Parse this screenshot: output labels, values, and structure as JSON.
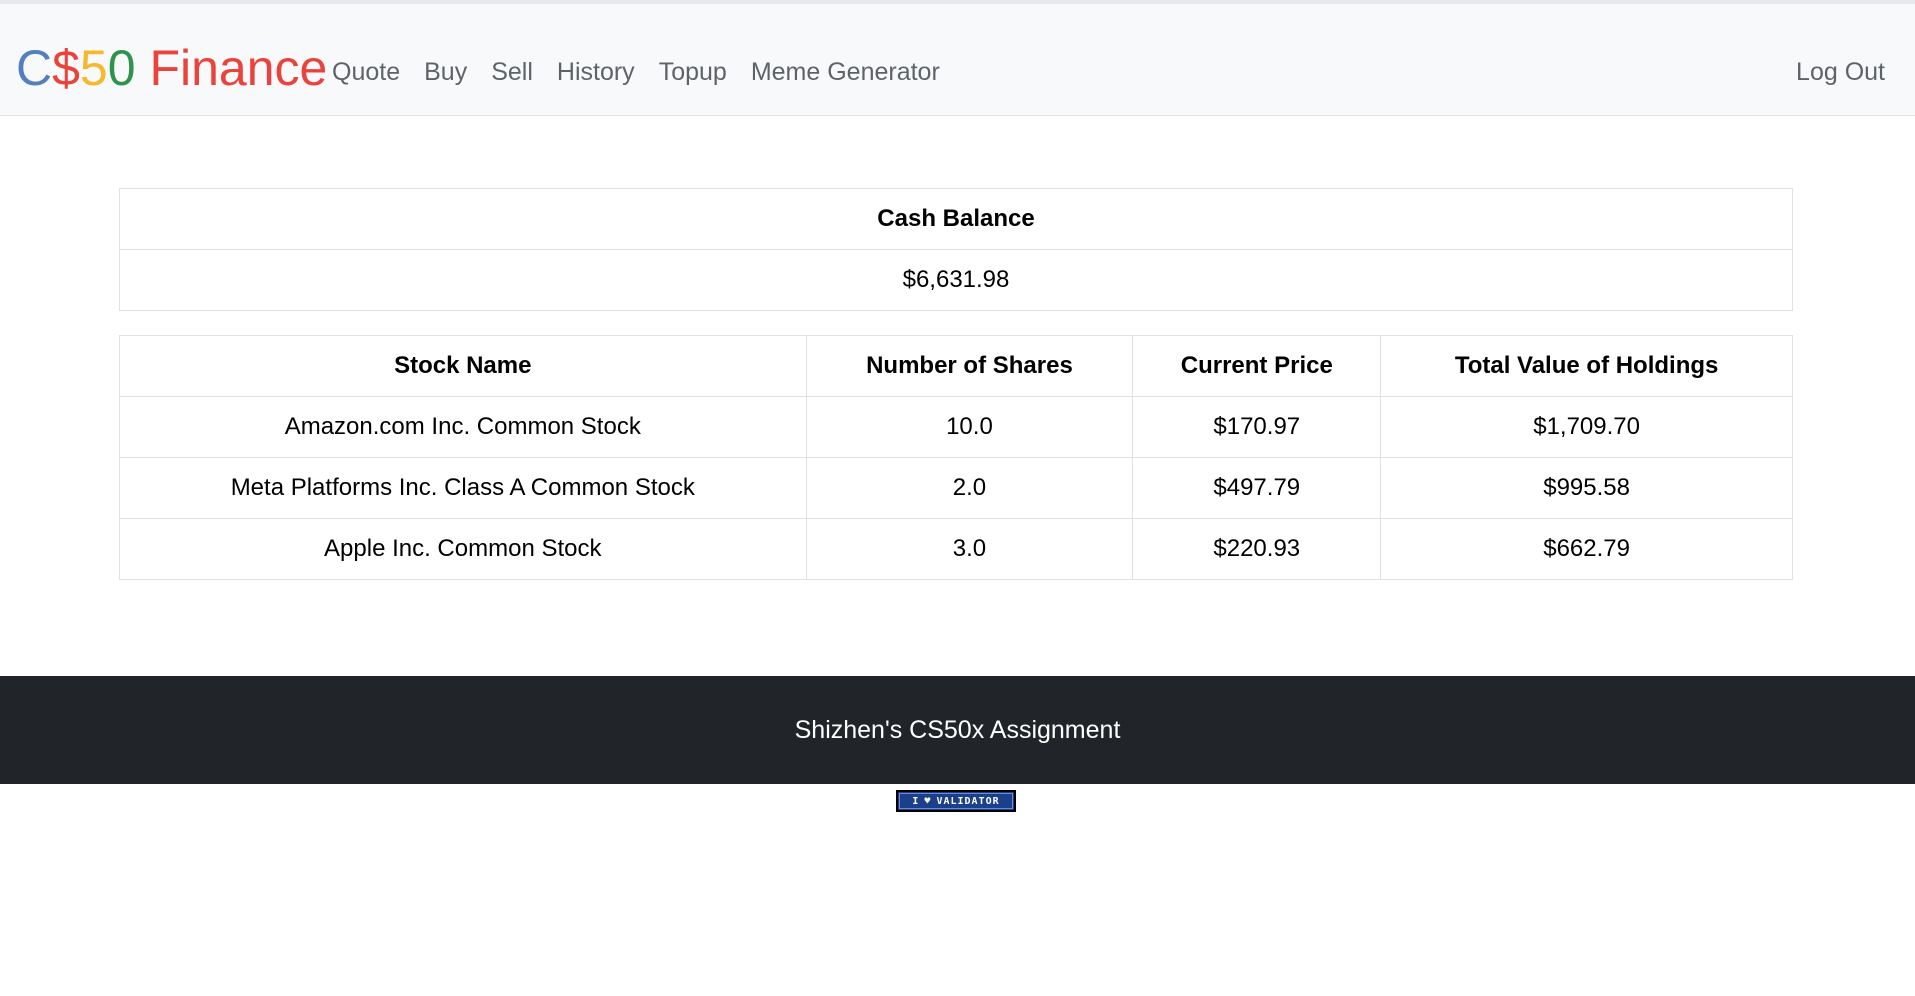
{
  "brand": {
    "part1": "C",
    "part2": "$",
    "part3": "5",
    "part4": "0",
    "part5": "Finance"
  },
  "nav": {
    "items": [
      {
        "label": "Quote"
      },
      {
        "label": "Buy"
      },
      {
        "label": "Sell"
      },
      {
        "label": "History"
      },
      {
        "label": "Topup"
      },
      {
        "label": "Meme Generator"
      }
    ],
    "logout": "Log Out"
  },
  "cash": {
    "header": "Cash Balance",
    "value": "$6,631.98"
  },
  "holdings": {
    "columns": [
      "Stock Name",
      "Number of Shares",
      "Current Price",
      "Total Value of Holdings"
    ],
    "rows": [
      [
        "Amazon.com Inc. Common Stock",
        "10.0",
        "$170.97",
        "$1,709.70"
      ],
      [
        "Meta Platforms Inc. Class A Common Stock",
        "2.0",
        "$497.79",
        "$995.58"
      ],
      [
        "Apple Inc. Common Stock",
        "3.0",
        "$220.93",
        "$662.79"
      ]
    ]
  },
  "footer": {
    "text": "Shizhen's CS50x Assignment"
  },
  "validator": {
    "left": "I",
    "heart": "♥",
    "right": "VALIDATOR"
  },
  "colors": {
    "brand_blue": "#537fbe",
    "brand_red": "#ea433b",
    "brand_yellow": "#f5b82e",
    "brand_green": "#2e944b",
    "footer_bg": "#212529",
    "navbar_bg": "#f8f9fa"
  }
}
